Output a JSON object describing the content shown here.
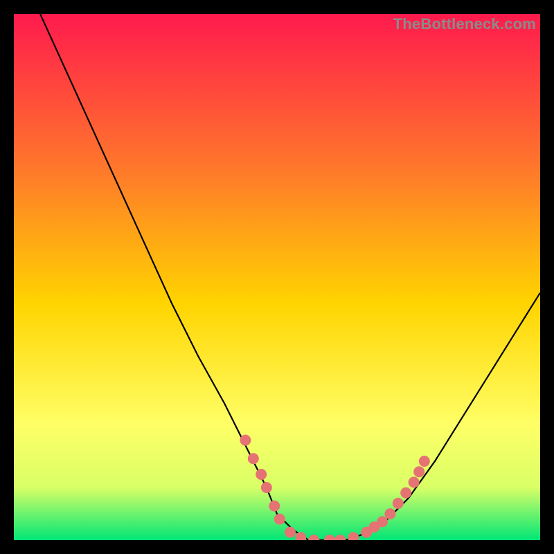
{
  "watermark": "TheBottleneck.com",
  "colors": {
    "gradient_top": "#ff1a4d",
    "gradient_mid1": "#ff7a2a",
    "gradient_mid2": "#ffd400",
    "gradient_mid3": "#ffff66",
    "gradient_mid4": "#d9ff66",
    "gradient_bottom": "#00e676",
    "curve": "#000000",
    "markers": "#e57373"
  },
  "chart_data": {
    "type": "line",
    "title": "",
    "xlabel": "",
    "ylabel": "",
    "xlim": [
      0,
      100
    ],
    "ylim": [
      0,
      100
    ],
    "series": [
      {
        "name": "bottleneck-curve",
        "x": [
          5,
          10,
          15,
          20,
          25,
          30,
          35,
          40,
          45,
          48,
          50,
          53,
          56,
          60,
          63,
          66,
          70,
          75,
          80,
          85,
          90,
          95,
          100
        ],
        "y": [
          100,
          89,
          78,
          67,
          56,
          45,
          35,
          26,
          16,
          10,
          5,
          2,
          0,
          0,
          0,
          1,
          3,
          8,
          15,
          23,
          31,
          39,
          47
        ]
      }
    ],
    "markers": [
      {
        "x": 44.0,
        "y": 19.0
      },
      {
        "x": 45.5,
        "y": 15.5
      },
      {
        "x": 47.0,
        "y": 12.5
      },
      {
        "x": 48.0,
        "y": 10.0
      },
      {
        "x": 49.5,
        "y": 6.5
      },
      {
        "x": 50.5,
        "y": 4.0
      },
      {
        "x": 52.5,
        "y": 1.5
      },
      {
        "x": 54.5,
        "y": 0.5
      },
      {
        "x": 57.0,
        "y": 0.0
      },
      {
        "x": 60.0,
        "y": 0.0
      },
      {
        "x": 62.0,
        "y": 0.0
      },
      {
        "x": 64.5,
        "y": 0.5
      },
      {
        "x": 67.0,
        "y": 1.5
      },
      {
        "x": 68.5,
        "y": 2.5
      },
      {
        "x": 70.0,
        "y": 3.5
      },
      {
        "x": 71.5,
        "y": 5.0
      },
      {
        "x": 73.0,
        "y": 7.0
      },
      {
        "x": 74.5,
        "y": 9.0
      },
      {
        "x": 76.0,
        "y": 11.0
      },
      {
        "x": 77.0,
        "y": 13.0
      },
      {
        "x": 78.0,
        "y": 15.0
      }
    ]
  }
}
